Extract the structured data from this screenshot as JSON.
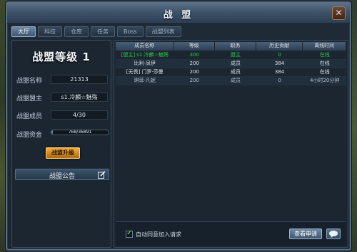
{
  "window": {
    "title": "战 盟",
    "close_label": "✕"
  },
  "tabs": [
    {
      "label": "大厅",
      "active": true
    },
    {
      "label": "科技",
      "active": false
    },
    {
      "label": "仓库",
      "active": false
    },
    {
      "label": "任务",
      "active": false
    },
    {
      "label": "Boss",
      "active": false
    },
    {
      "label": "战盟列表",
      "active": false
    }
  ],
  "guild": {
    "level_title": "战盟等级 1",
    "name_label": "战盟名称",
    "name_value": "21313",
    "leader_label": "战盟盟主",
    "leader_value": "s1.冷麟☆魅殇",
    "members_label": "战盟成员",
    "members_value": "4/30",
    "fund_label": "战盟资金",
    "fund_value": "768/36891",
    "fund_fraction": 0.021,
    "upgrade_label": "战盟升级",
    "notice_label": "战盟公告"
  },
  "table": {
    "columns": [
      "成员名称",
      "等级",
      "职务",
      "历史贡献",
      "离线时间"
    ],
    "rows": [
      {
        "name": "[盟主] s1.冷麟☆魅殇",
        "level": "300",
        "role": "盟主",
        "contribution": "0",
        "offline": "在线",
        "type": "leader"
      },
      {
        "name": "比利·凤伊",
        "level": "200",
        "role": "成员",
        "contribution": "384",
        "offline": "在线",
        "type": "normal"
      },
      {
        "name": "[无畏] 门罗·莎曼",
        "level": "200",
        "role": "成员",
        "contribution": "384",
        "offline": "在线",
        "type": "normal"
      },
      {
        "name": "琪菲·凡妮",
        "level": "200",
        "role": "成员",
        "contribution": "0",
        "offline": "4小时20分钟",
        "type": "dim"
      }
    ]
  },
  "bottom": {
    "auto_accept_label": "自动同意加入请求",
    "auto_accept_checked": true,
    "view_requests_label": "查看申请"
  },
  "colors": {
    "leader_green": "#2ec84a",
    "upgrade_gold": "#f0b040",
    "accent_blue": "#6f8aa6"
  },
  "icons": {
    "close": "close-icon",
    "edit": "edit-icon",
    "chat": "chat-bubble-icon",
    "check": "checkmark-icon"
  }
}
